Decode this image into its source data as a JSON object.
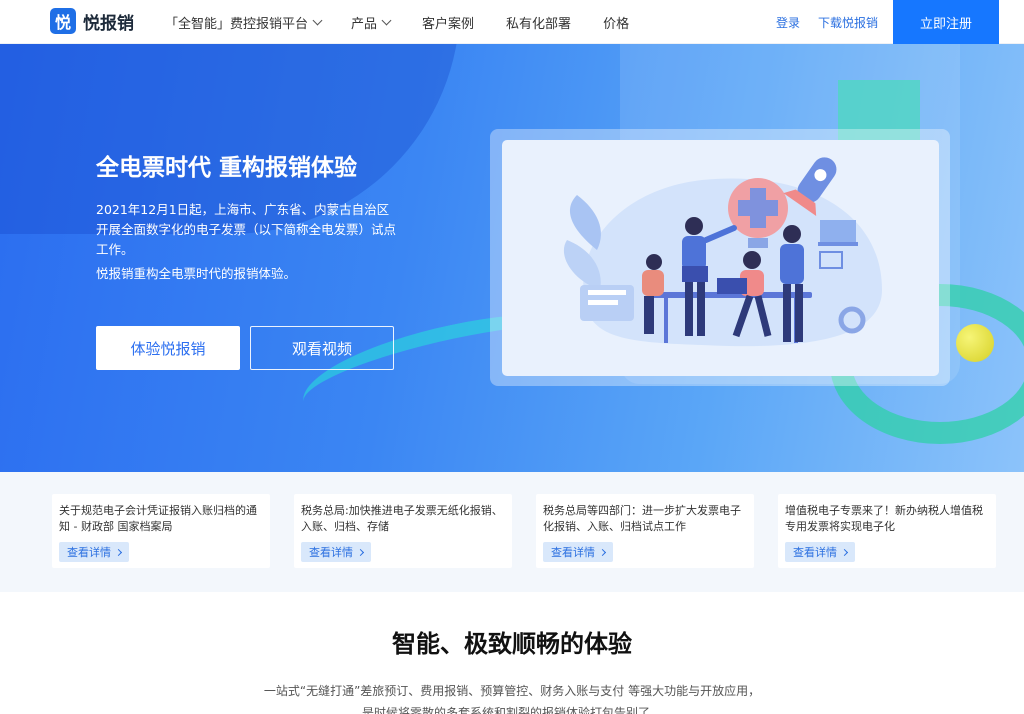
{
  "header": {
    "logo_glyph": "悦",
    "logo_text": "悦报销",
    "nav": [
      {
        "label": "「全智能」费控报销平台",
        "dropdown": true
      },
      {
        "label": "产品",
        "dropdown": true
      },
      {
        "label": "客户案例",
        "dropdown": false
      },
      {
        "label": "私有化部署",
        "dropdown": false
      },
      {
        "label": "价格",
        "dropdown": false
      }
    ],
    "login": "登录",
    "download": "下载悦报销",
    "register": "立即注册"
  },
  "hero": {
    "title": "全电票时代 重构报销体验",
    "desc": "2021年12月1日起，上海市、广东省、内蒙古自治区开展全面数字化的电子发票（以下简称全电发票）试点工作。",
    "desc2": "悦报销重构全电票时代的报销体验。",
    "btn_primary": "体验悦报销",
    "btn_video": "观看视频"
  },
  "news": [
    {
      "text": "关于规范电子会计凭证报销入账归档的通知 - 财政部 国家档案局",
      "btn": "查看详情"
    },
    {
      "text": "税务总局:加快推进电子发票无纸化报销、入账、归档、存储",
      "btn": "查看详情"
    },
    {
      "text": "税务总局等四部门：进一步扩大发票电子化报销、入账、归档试点工作",
      "btn": "查看详情"
    },
    {
      "text": "增值税电子专票来了！新办纳税人增值税专用发票将实现电子化",
      "btn": "查看详情"
    }
  ],
  "features": {
    "title": "智能、极致顺畅的体验",
    "desc_line1": "一站式“无缝打通”差旅预订、费用报销、预算管控、财务入账与支付 等强大功能与开放应用，",
    "desc_line2": "是时候将零散的多套系统和割裂的报销体验打包告别了。"
  },
  "colors": {
    "accent": "#1677ff",
    "hero": "#2b6df0"
  }
}
